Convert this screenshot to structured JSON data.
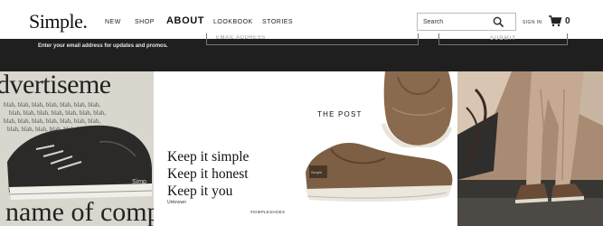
{
  "brand": {
    "logo": "Simple."
  },
  "nav": {
    "items": [
      {
        "label": "NEW",
        "active": false
      },
      {
        "label": "SHOP",
        "active": false
      },
      {
        "label": "ABOUT",
        "active": true
      },
      {
        "label": "LOOKBOOK",
        "active": false
      },
      {
        "label": "STORIES",
        "active": false
      }
    ]
  },
  "header": {
    "search_placeholder": "Search",
    "signin_label": "SIGN IN",
    "cart_count": "0",
    "icons": {
      "search": "search-icon",
      "cart": "cart-icon"
    }
  },
  "newsletter": {
    "prompt": "Enter your email address for updates and promos.",
    "email_placeholder": "EMAIL ADDRESS",
    "submit_label": "SUBMIT"
  },
  "hero": {
    "panel1": {
      "headline": "dvertiseme",
      "footer": "name of comp",
      "blah": "blah, blah, blah, blah, blah, blah, blah,"
    },
    "panel2": {
      "quote_lines": [
        "Keep it simple",
        "Keep it honest",
        "Keep it you"
      ],
      "attribution": "Unknown",
      "hashtag": "#SIMPLESHOES"
    },
    "panel3": {
      "title": "THE POST"
    }
  },
  "colors": {
    "band_bg": "#1f1f1f",
    "text": "#111111",
    "shoe_brown": "#8a6a4e"
  }
}
